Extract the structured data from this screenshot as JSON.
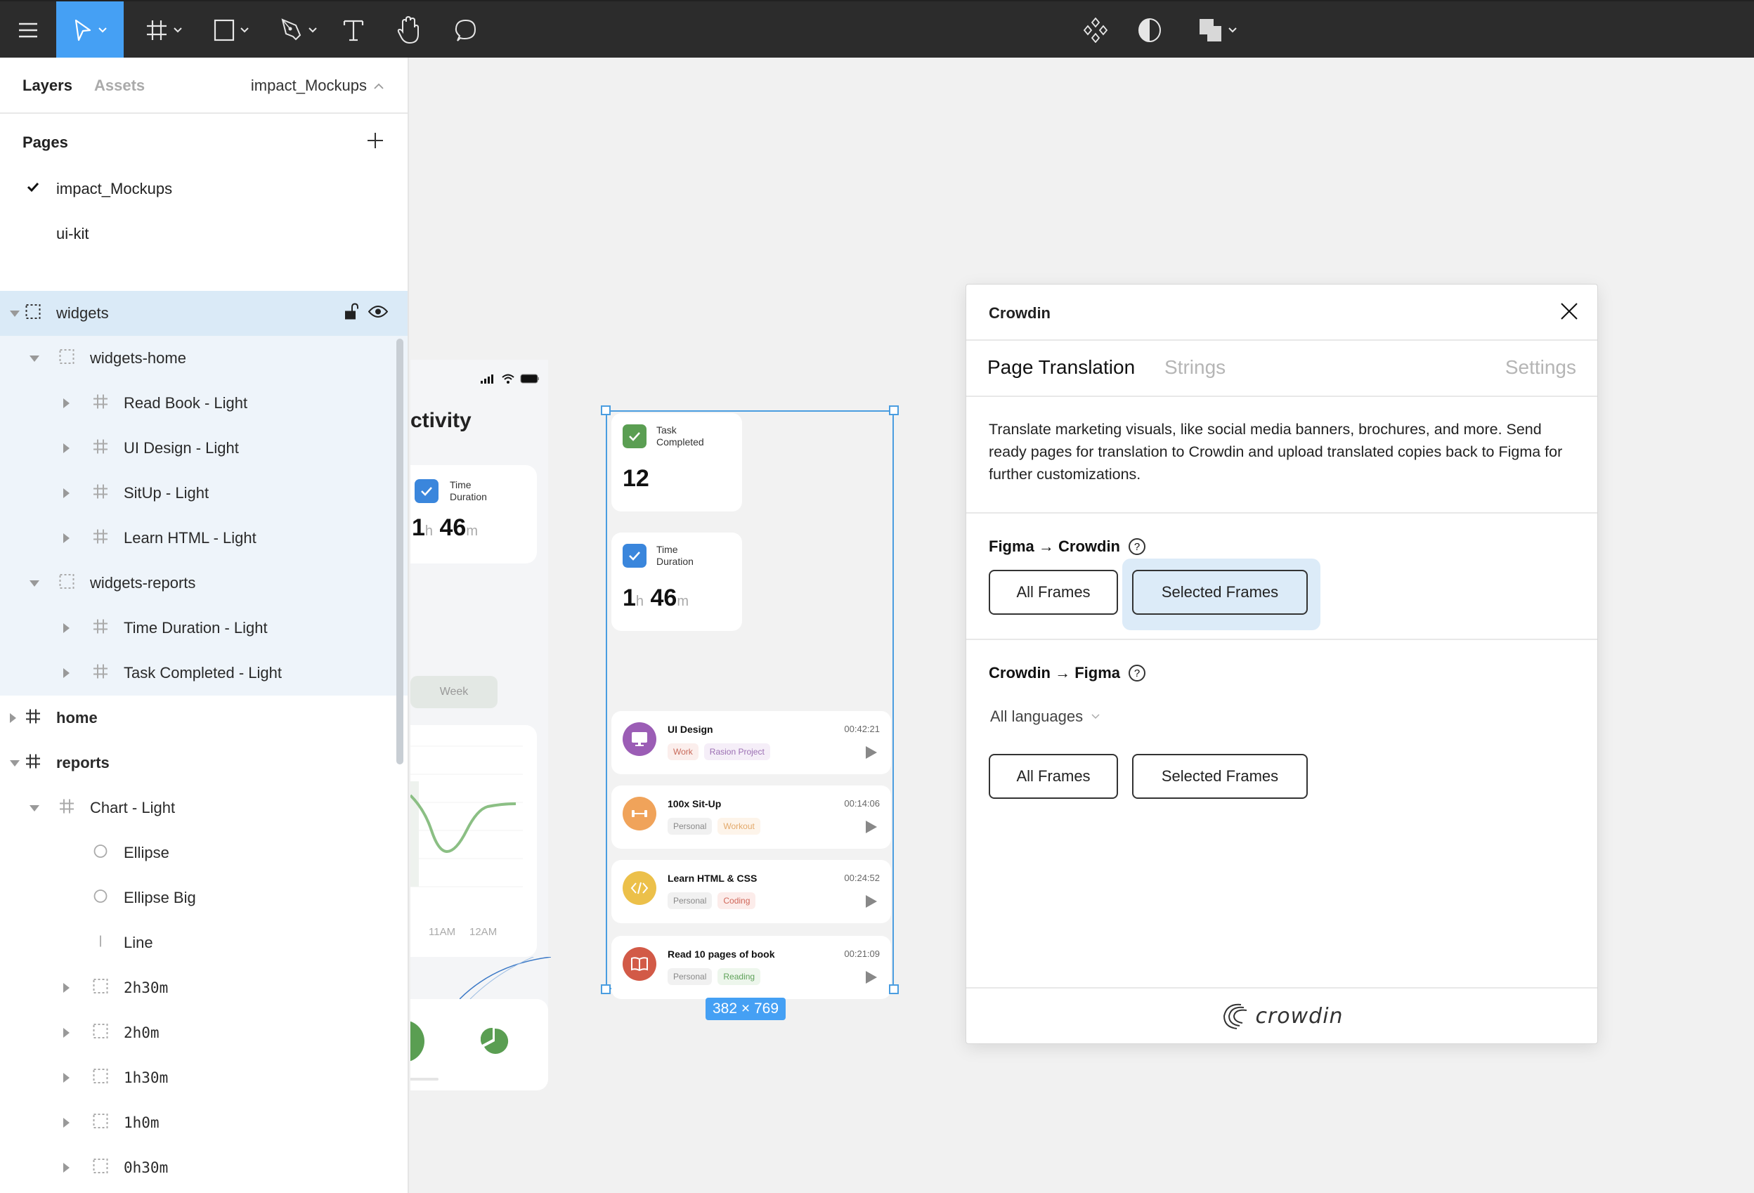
{
  "toolbar": {
    "tools": [
      {
        "name": "main-menu",
        "icon": "hamburger-icon"
      },
      {
        "name": "move-tool",
        "icon": "cursor-icon",
        "active": true,
        "has_dropdown": true
      },
      {
        "name": "frame-tool",
        "icon": "frame-hash-icon",
        "has_dropdown": true
      },
      {
        "name": "shape-tool",
        "icon": "rectangle-icon",
        "has_dropdown": true
      },
      {
        "name": "pen-tool",
        "icon": "pen-icon",
        "has_dropdown": true
      },
      {
        "name": "text-tool",
        "icon": "text-icon"
      },
      {
        "name": "hand-tool",
        "icon": "hand-icon"
      },
      {
        "name": "comment-tool",
        "icon": "comment-icon"
      }
    ],
    "center_tools": [
      {
        "name": "components",
        "icon": "components-icon"
      },
      {
        "name": "mask",
        "icon": "contrast-icon"
      },
      {
        "name": "boolean",
        "icon": "boolean-icon",
        "has_dropdown": true
      }
    ],
    "accent_color": "#45a0f4"
  },
  "left_panel": {
    "tabs": {
      "layers": "Layers",
      "assets": "Assets"
    },
    "file_name": "impact_Mockups",
    "pages_title": "Pages",
    "pages": [
      {
        "label": "impact_Mockups",
        "current": true
      },
      {
        "label": "ui-kit",
        "current": false
      }
    ],
    "layers": [
      {
        "label": "widgets",
        "depth": 0,
        "type": "group",
        "expanded": true,
        "selected": "top"
      },
      {
        "label": "widgets-home",
        "depth": 1,
        "type": "group",
        "expanded": true,
        "selected": "child"
      },
      {
        "label": "Read Book - Light",
        "depth": 2,
        "type": "frame",
        "expanded": false,
        "selected": "child"
      },
      {
        "label": "UI Design - Light",
        "depth": 2,
        "type": "frame",
        "expanded": false,
        "selected": "child"
      },
      {
        "label": "SitUp - Light",
        "depth": 2,
        "type": "frame",
        "expanded": false,
        "selected": "child"
      },
      {
        "label": "Learn HTML - Light",
        "depth": 2,
        "type": "frame",
        "expanded": false,
        "selected": "child"
      },
      {
        "label": "widgets-reports",
        "depth": 1,
        "type": "group",
        "expanded": true,
        "selected": "child"
      },
      {
        "label": "Time Duration - Light",
        "depth": 2,
        "type": "frame",
        "expanded": false,
        "selected": "child"
      },
      {
        "label": "Task Completed - Light",
        "depth": 2,
        "type": "frame",
        "expanded": false,
        "selected": "child"
      },
      {
        "label": "home",
        "depth": 0,
        "type": "frame-top",
        "expanded": false,
        "bold": true
      },
      {
        "label": "reports",
        "depth": 0,
        "type": "frame-top",
        "expanded": true,
        "bold": true
      },
      {
        "label": "Chart - Light",
        "depth": 1,
        "type": "frame",
        "expanded": true
      },
      {
        "label": "Ellipse",
        "depth": 2,
        "type": "ellipse",
        "leaf": true
      },
      {
        "label": "Ellipse Big",
        "depth": 2,
        "type": "ellipse",
        "leaf": true
      },
      {
        "label": "Line",
        "depth": 2,
        "type": "line",
        "leaf": true
      },
      {
        "label": "2h30m",
        "depth": 2,
        "type": "group",
        "expanded": false,
        "mono": true
      },
      {
        "label": "2h0m",
        "depth": 2,
        "type": "group",
        "expanded": false,
        "mono": true
      },
      {
        "label": "1h30m",
        "depth": 2,
        "type": "group",
        "expanded": false,
        "mono": true
      },
      {
        "label": "1h0m",
        "depth": 2,
        "type": "group",
        "expanded": false,
        "mono": true
      },
      {
        "label": "0h30m",
        "depth": 2,
        "type": "group",
        "expanded": false,
        "mono": true
      }
    ]
  },
  "canvas": {
    "partial_phone": {
      "title": "ctivity",
      "time_label_1": "Time",
      "time_label_2": "Duration",
      "hours": "1",
      "hours_unit": "h",
      "minutes": "46",
      "minutes_unit": "m",
      "week_button": "Week",
      "x_ticks": [
        "11AM",
        "12AM"
      ]
    },
    "selected_frame": {
      "size_label": "382 × 769",
      "task_card": {
        "label_1": "Task",
        "label_2": "Completed",
        "value": "12",
        "color": "#5a9e52"
      },
      "time_card": {
        "label_1": "Time",
        "label_2": "Duration",
        "hours": "1",
        "hours_unit": "h",
        "minutes": "46",
        "minutes_unit": "m",
        "color": "#3a86dc"
      },
      "tasks": [
        {
          "title": "UI Design",
          "time": "00:42:21",
          "icon": "monitor-icon",
          "color": "#9b5db5",
          "tags": [
            {
              "label": "Work",
              "fg": "#c8695a",
              "bg": "#fbeeec"
            },
            {
              "label": "Rasion Project",
              "fg": "#9b6fb3",
              "bg": "#f5eef8"
            }
          ]
        },
        {
          "title": "100x Sit-Up",
          "time": "00:14:06",
          "icon": "dumbbell-icon",
          "color": "#f0a35a",
          "tags": [
            {
              "label": "Personal",
              "fg": "#888888",
              "bg": "#f1f1f1"
            },
            {
              "label": "Workout",
              "fg": "#e3a96a",
              "bg": "#fdf4ea"
            }
          ]
        },
        {
          "title": "Learn HTML & CSS",
          "time": "00:24:52",
          "icon": "code-icon",
          "color": "#ecc04a",
          "tags": [
            {
              "label": "Personal",
              "fg": "#888888",
              "bg": "#f1f1f1"
            },
            {
              "label": "Coding",
              "fg": "#d0675a",
              "bg": "#fcecea"
            }
          ]
        },
        {
          "title": "Read 10 pages of book",
          "time": "00:21:09",
          "icon": "book-icon",
          "color": "#d25a47",
          "tags": [
            {
              "label": "Personal",
              "fg": "#888888",
              "bg": "#f1f1f1"
            },
            {
              "label": "Reading",
              "fg": "#5fa25a",
              "bg": "#edf6ec"
            }
          ]
        }
      ]
    }
  },
  "plugin": {
    "title": "Crowdin",
    "tabs": [
      {
        "label": "Page Translation",
        "active": true
      },
      {
        "label": "Strings",
        "active": false
      },
      {
        "label": "Settings",
        "active": false
      }
    ],
    "description": "Translate marketing visuals, like social media banners, brochures, and more. Send ready pages for translation to Crowdin and upload translated copies back to Figma for further customizations.",
    "upload_section": {
      "title": "Figma → Crowdin",
      "help": "?",
      "buttons": [
        {
          "label": "All Frames",
          "selected": false
        },
        {
          "label": "Selected Frames",
          "selected": true
        }
      ]
    },
    "download_section": {
      "title": "Crowdin → Figma",
      "help": "?",
      "language_select": "All languages",
      "buttons": [
        {
          "label": "All Frames",
          "selected": false
        },
        {
          "label": "Selected Frames",
          "selected": false
        }
      ]
    },
    "footer_logo": "crowdin"
  }
}
